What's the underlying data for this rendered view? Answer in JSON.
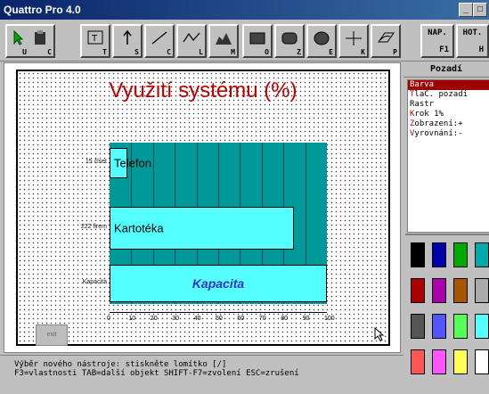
{
  "window": {
    "title": "Quattro Pro 4.0"
  },
  "toolbar": {
    "buttons": [
      {
        "icon": "pointer-arrow",
        "hotkey": "U"
      },
      {
        "icon": "clipboard",
        "hotkey": "C"
      },
      {
        "icon": "text-box",
        "hotkey": "T"
      },
      {
        "icon": "arrow",
        "hotkey": "S"
      },
      {
        "icon": "line",
        "hotkey": "C"
      },
      {
        "icon": "polyline",
        "hotkey": "L"
      },
      {
        "icon": "polygon",
        "hotkey": "M"
      },
      {
        "icon": "rectangle",
        "hotkey": "O"
      },
      {
        "icon": "rounded-rectangle",
        "hotkey": "Z"
      },
      {
        "icon": "ellipse",
        "hotkey": "E"
      },
      {
        "icon": "vertical-horizontal-line",
        "hotkey": "K"
      },
      {
        "icon": "free-draw",
        "hotkey": "P"
      }
    ],
    "nap_label": "NAP.",
    "nap_key": "F1",
    "hot_label": "HOT.",
    "hot_key": "H"
  },
  "chart": {
    "title": "Využití systému (%)",
    "exit_label": "exit"
  },
  "chart_data": {
    "type": "bar",
    "orientation": "horizontal",
    "title": "Využití systému (%)",
    "categories": [
      "15 člset",
      "222 firem",
      "Kapacita"
    ],
    "bar_labels": [
      "Telefon",
      "Kartotéka",
      "Kapacita"
    ],
    "values": [
      8,
      85,
      100
    ],
    "xlim": [
      0,
      100
    ],
    "xticks": [
      "0",
      "10",
      "20",
      "30",
      "40",
      "50",
      "60",
      "70",
      "80",
      "90",
      "100"
    ],
    "grid": true
  },
  "panel": {
    "title": "Pozadí",
    "items": [
      {
        "key": "B",
        "rest": "arva"
      },
      {
        "key": "T",
        "rest": "laČ. pozadi"
      },
      {
        "key": "",
        "rest": "Rastr"
      },
      {
        "key": "K",
        "rest": "rok        1%"
      },
      {
        "key": "Z",
        "rest": "obrazení:+"
      },
      {
        "key": "V",
        "rest": "yrovnání:-"
      }
    ]
  },
  "palette": {
    "colors": [
      "#000000",
      "#0000aa",
      "#00aa00",
      "#00aaaa",
      "#aa0000",
      "#aa00aa",
      "#aa5500",
      "#aaaaaa",
      "#555555",
      "#5555ff",
      "#55ff55",
      "#55ffff",
      "#ff5555",
      "#ff55ff",
      "#ffff55",
      "#ffffff"
    ]
  },
  "status": {
    "line1": "Výběr nového nástroje: stiskněte lomítko [/]",
    "line2": "F3=vlastnosti  TAB=další objekt  SHIFT-F7=zvolení  ESC=zrušení"
  }
}
